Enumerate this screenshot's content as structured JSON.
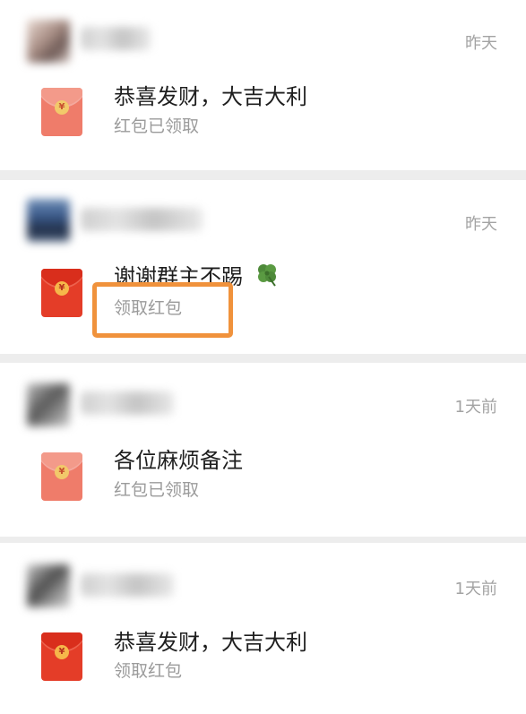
{
  "messages": [
    {
      "time": "昨天",
      "text": "恭喜发财，大吉大利",
      "status": "红包已领取",
      "claimed": true
    },
    {
      "time": "昨天",
      "text": "谢谢群主不踢",
      "emoji_icon": "four-leaf-clover-icon",
      "status": "领取红包",
      "claimed": false,
      "highlighted": true,
      "highlight_color": "#f0923c"
    },
    {
      "time": "1天前",
      "text": "各位麻烦备注",
      "status": "红包已领取",
      "claimed": true
    },
    {
      "time": "1天前",
      "text": "恭喜发财，大吉大利",
      "status": "领取红包",
      "claimed": false
    }
  ],
  "envelope": {
    "coin_symbol": "¥",
    "claimed_color": "#ef7c6a",
    "unclaimed_color": "#e43d28"
  },
  "colors": {
    "background": "#ededed",
    "card": "#ffffff",
    "time_text": "#a3a3a3",
    "status_text": "#9b9b9b"
  }
}
